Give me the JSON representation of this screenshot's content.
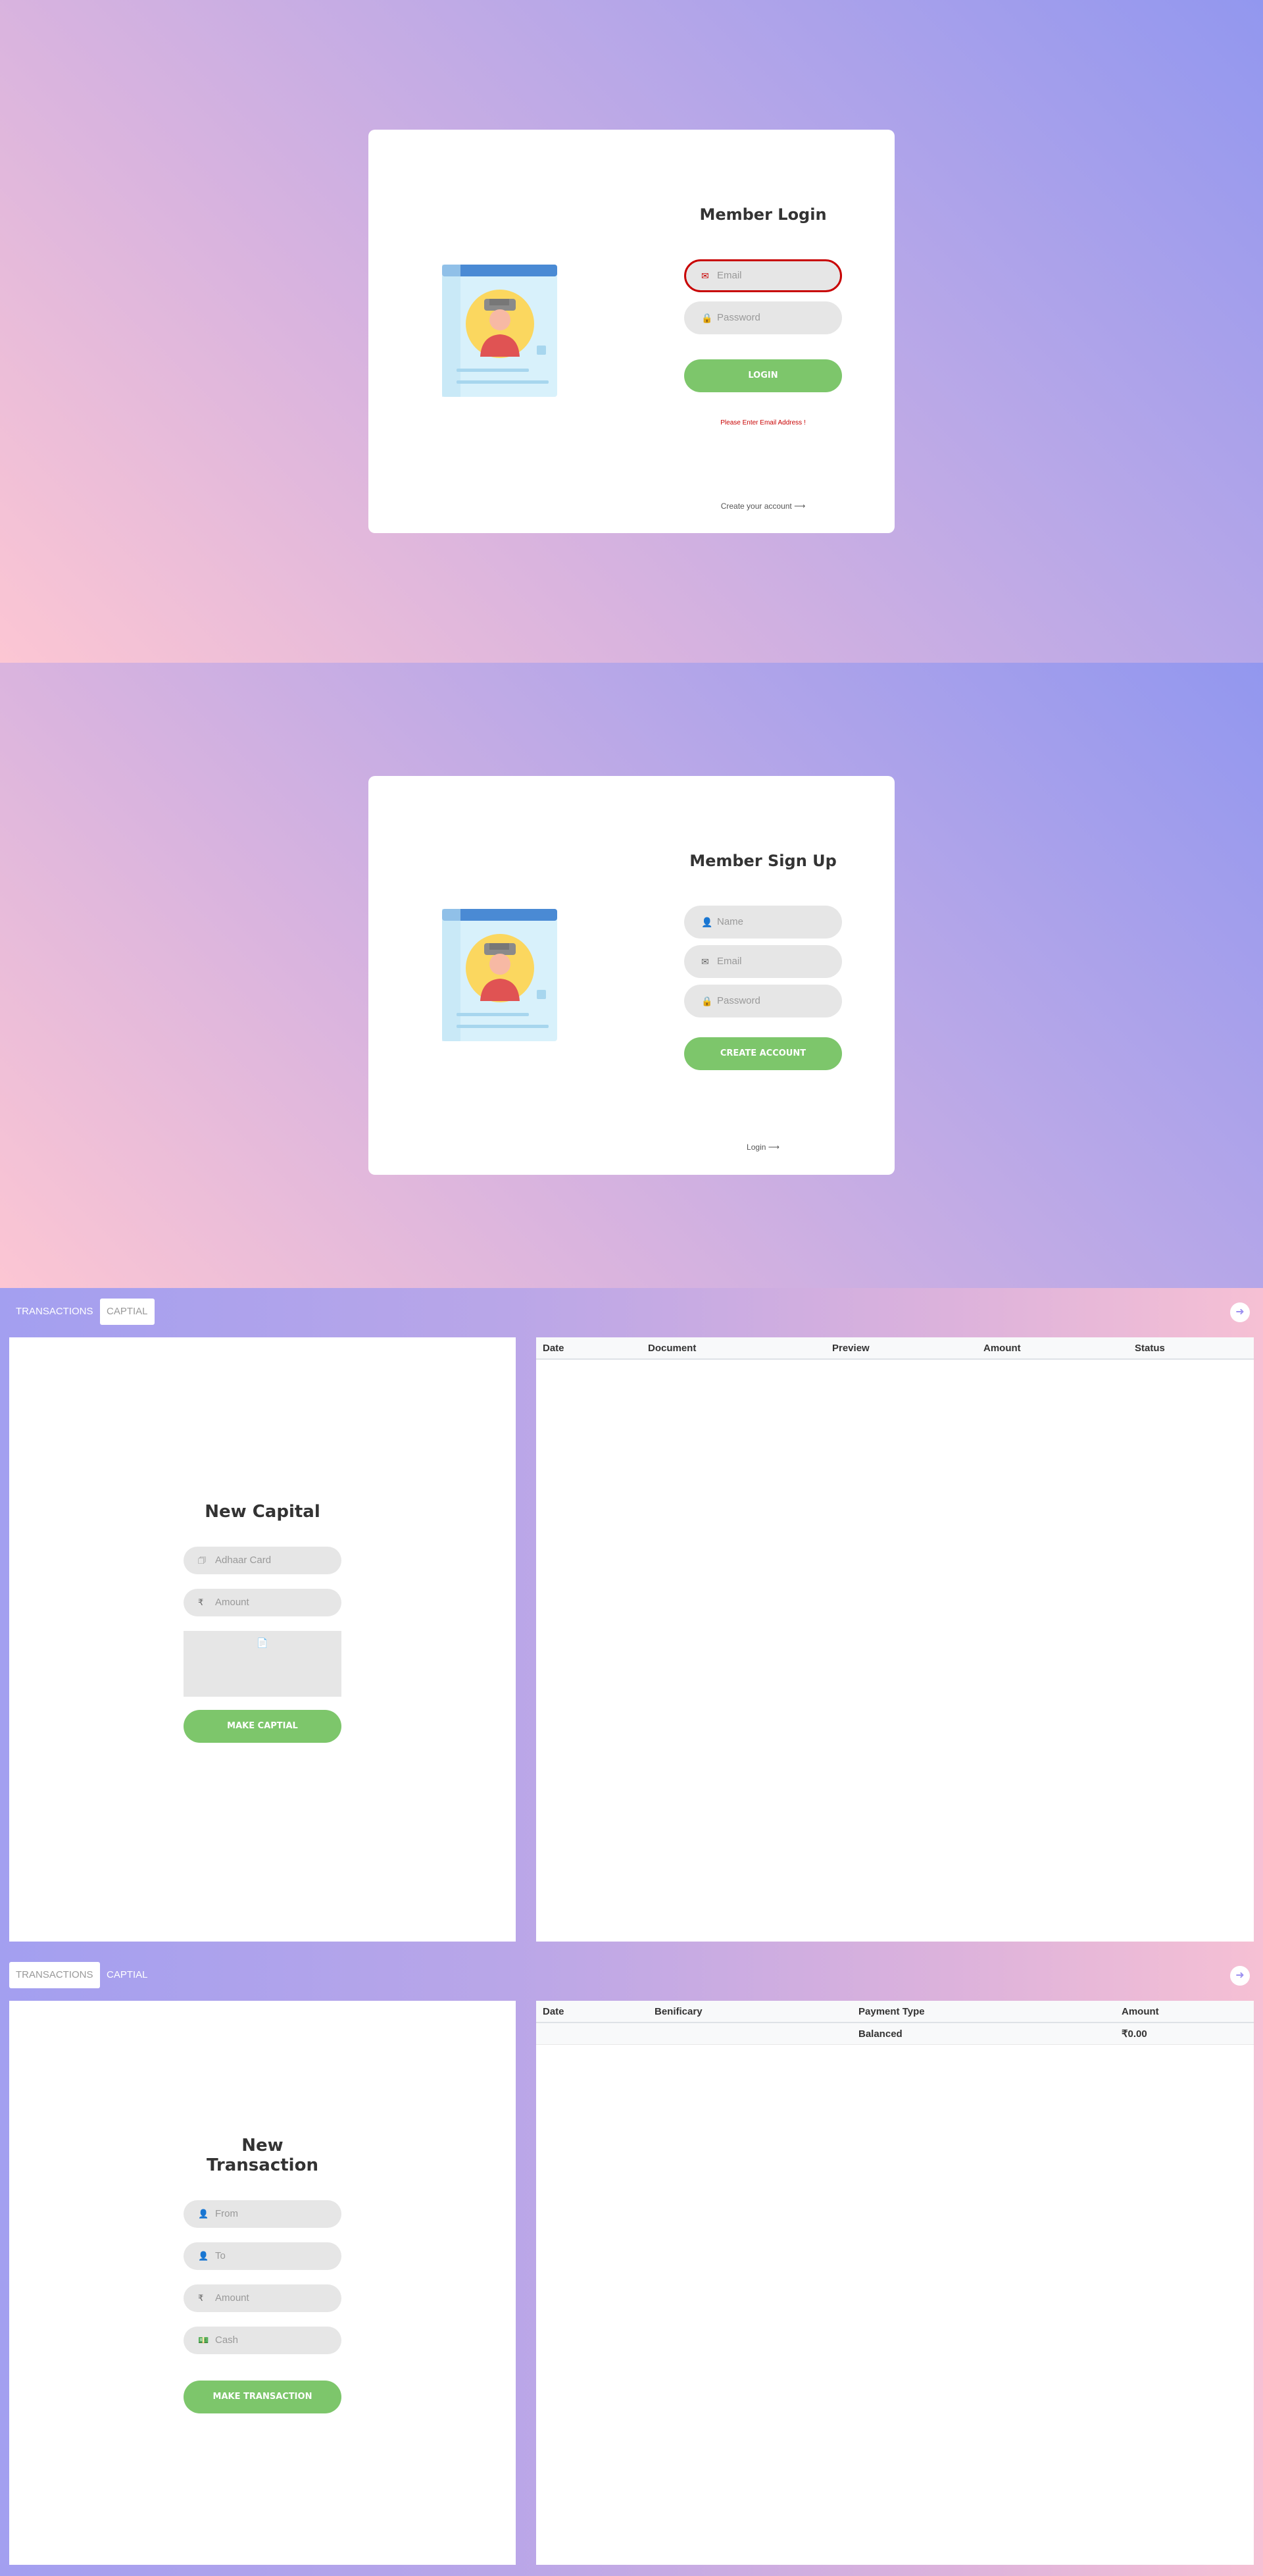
{
  "login": {
    "title": "Member Login",
    "email_placeholder": "Email",
    "password_placeholder": "Password",
    "button": "Login",
    "error": "Please Enter Email Address !",
    "link": "Create your account ⟶"
  },
  "signup": {
    "title": "Member Sign Up",
    "name_placeholder": "Name",
    "email_placeholder": "Email",
    "password_placeholder": "Password",
    "button": "Create Account",
    "link": "Login ⟶"
  },
  "tabs": {
    "transactions": "TRANSACTIONS",
    "capital": "CAPTIAL"
  },
  "capital": {
    "title": "New Capital",
    "adhaar_placeholder": "Adhaar Card",
    "amount_placeholder": "Amount",
    "button": "Make Captial",
    "table": {
      "headers": [
        "Date",
        "Document",
        "Preview",
        "Amount",
        "Status"
      ]
    }
  },
  "transaction": {
    "title": "New Transaction",
    "from_placeholder": "From",
    "to_placeholder": "To",
    "amount_placeholder": "Amount",
    "cash_placeholder": "Cash",
    "button": "Make Transaction",
    "table": {
      "headers": [
        "Date",
        "Benificary",
        "Payment Type",
        "Amount"
      ],
      "rows": [
        {
          "date": "",
          "beneficiary": "",
          "payment_type": "Balanced",
          "amount": "₹0.00"
        }
      ]
    }
  },
  "icons": {
    "email": "envelope-icon",
    "password": "lock-icon",
    "name": "user-icon",
    "amount": "rupee-icon",
    "card": "id-card-icon",
    "file": "file-icon",
    "cash": "money-icon",
    "logout": "logout-icon"
  },
  "colors": {
    "accent": "#7dc66b",
    "error": "#c80000",
    "card_blue": "#4a8ad4",
    "card_bg": "#d8f1fb",
    "avatar_bg": "#fbd75f"
  }
}
